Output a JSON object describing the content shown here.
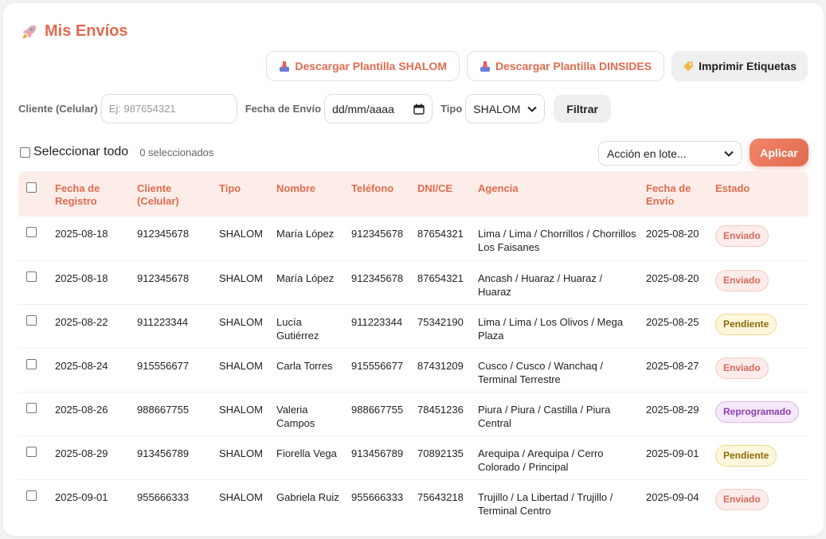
{
  "header": {
    "title": "Mis Envíos",
    "icon": "rocket-icon"
  },
  "actions": {
    "download_shalom": "Descargar Plantilla SHALOM",
    "download_dinsides": "Descargar Plantilla DINSIDES",
    "print_labels": "Imprimir Etiquetas"
  },
  "filters": {
    "client_label": "Cliente (Celular)",
    "client_placeholder": "Ej: 987654321",
    "date_label": "Fecha de Envío",
    "date_value": "dd/mm/aaaa",
    "type_label": "Tipo",
    "type_value": "SHALOM",
    "filter_button": "Filtrar"
  },
  "bulk": {
    "select_all": "Seleccionar todo",
    "selected_count": "0 seleccionados",
    "action_placeholder": "Acción en lote...",
    "apply_button": "Aplicar"
  },
  "table": {
    "headers": [
      "Fecha de Registro",
      "Cliente (Celular)",
      "Tipo",
      "Nombre",
      "Teléfono",
      "DNI/CE",
      "Agencia",
      "Fecha de Envío",
      "Estado"
    ],
    "rows": [
      [
        "2025-08-18",
        "912345678",
        "SHALOM",
        "María López",
        "912345678",
        "87654321",
        "Lima / Lima / Chorrillos / Chorrillos Los Faisanes",
        "2025-08-20",
        "Enviado"
      ],
      [
        "2025-08-18",
        "912345678",
        "SHALOM",
        "María López",
        "912345678",
        "87654321",
        "Ancash / Huaraz / Huaraz / Huaraz",
        "2025-08-20",
        "Enviado"
      ],
      [
        "2025-08-22",
        "911223344",
        "SHALOM",
        "Lucía Gutiérrez",
        "911223344",
        "75342190",
        "Lima / Lima / Los Olivos / Mega Plaza",
        "2025-08-25",
        "Pendiente"
      ],
      [
        "2025-08-24",
        "915556677",
        "SHALOM",
        "Carla Torres",
        "915556677",
        "87431209",
        "Cusco / Cusco / Wanchaq / Terminal Terrestre",
        "2025-08-27",
        "Enviado"
      ],
      [
        "2025-08-26",
        "988667755",
        "SHALOM",
        "Valeria Campos",
        "988667755",
        "78451236",
        "Piura / Piura / Castilla / Piura Central",
        "2025-08-29",
        "Reprogramado"
      ],
      [
        "2025-08-29",
        "913456789",
        "SHALOM",
        "Fiorella Vega",
        "913456789",
        "70892135",
        "Arequipa / Arequipa / Cerro Colorado / Principal",
        "2025-09-01",
        "Pendiente"
      ],
      [
        "2025-09-01",
        "955666333",
        "SHALOM",
        "Gabriela Ruiz",
        "955666333",
        "75643218",
        "Trujillo / La Libertad / Trujillo / Terminal Centro",
        "2025-09-04",
        "Enviado"
      ]
    ]
  },
  "colors": {
    "accent": "#e06b4f",
    "header_bg": "#fdede8"
  }
}
